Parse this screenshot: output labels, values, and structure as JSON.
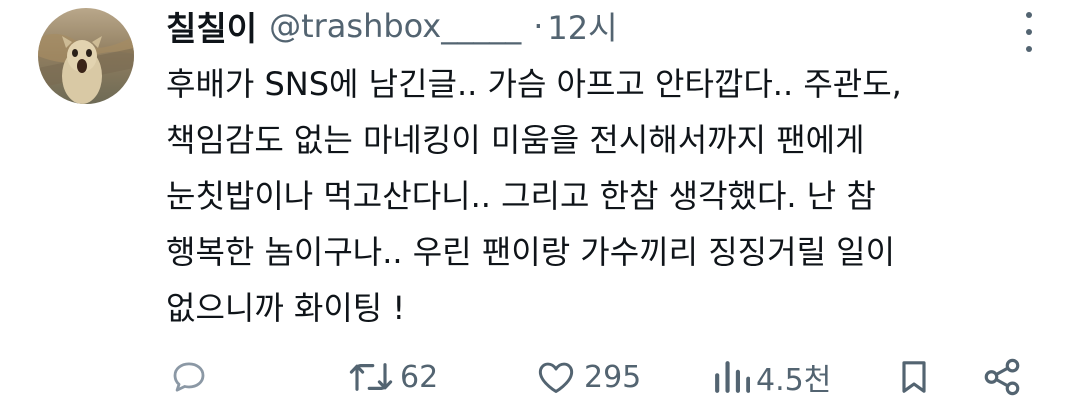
{
  "author": {
    "display_name": "칠칠이",
    "handle": "@trashbox_____",
    "separator": "·",
    "time": "12시"
  },
  "tweet": {
    "lines": [
      "후배가 SNS에 남긴글.. 가슴 아프고 안타깝다.. 주관도,",
      "책임감도 없는 마네킹이 미움을 전시해서까지 팬에게",
      "눈칫밥이나 먹고산다니.. 그리고 한참 생각했다. 난 참",
      "행복한 놈이구나.. 우린 팬이랑 가수끼리 징징거릴 일이",
      "없으니까 화이팅 !"
    ]
  },
  "actions": {
    "reply": {
      "icon": "reply-icon",
      "count": ""
    },
    "retweet": {
      "icon": "retweet-icon",
      "count": "62"
    },
    "like": {
      "icon": "heart-icon",
      "count": "295"
    },
    "views": {
      "icon": "views-icon",
      "count": "4.5천"
    },
    "bookmark": {
      "icon": "bookmark-icon"
    },
    "share": {
      "icon": "share-icon"
    }
  },
  "colors": {
    "text": "#0f1419",
    "secondary": "#536471"
  }
}
